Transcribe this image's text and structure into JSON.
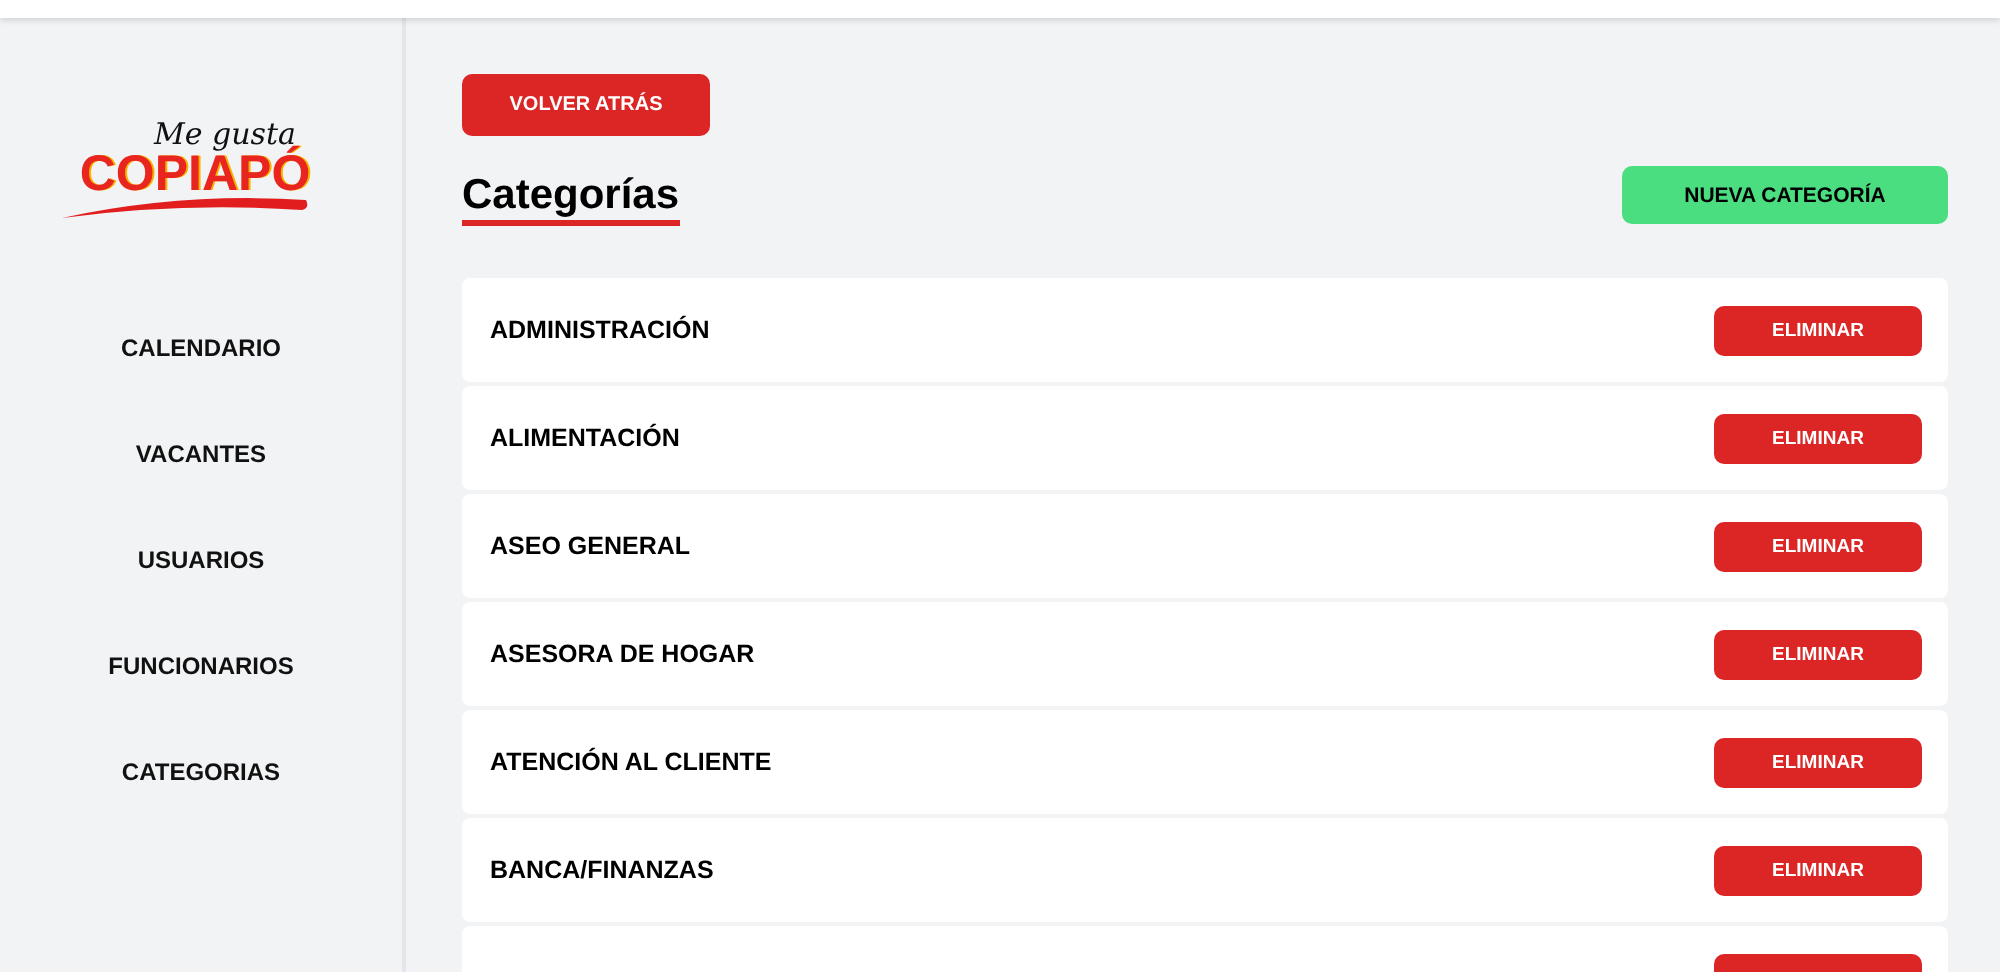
{
  "sidebar": {
    "logo": {
      "tagline": "Me gusta",
      "name": "COPIAPÓ"
    },
    "items": [
      {
        "label": "CALENDARIO"
      },
      {
        "label": "VACANTES"
      },
      {
        "label": "USUARIOS"
      },
      {
        "label": "FUNCIONARIOS"
      },
      {
        "label": "CATEGORIAS"
      }
    ]
  },
  "back_button": "VOLVER ATRÁS",
  "title": "Categorías",
  "new_button": "NUEVA CATEGORÍA",
  "categories": [
    {
      "name": "ADMINISTRACIÓN",
      "action": "ELIMINAR"
    },
    {
      "name": "ALIMENTACIÓN",
      "action": "ELIMINAR"
    },
    {
      "name": "ASEO GENERAL",
      "action": "ELIMINAR"
    },
    {
      "name": "ASESORA DE HOGAR",
      "action": "ELIMINAR"
    },
    {
      "name": "ATENCIÓN AL CLIENTE",
      "action": "ELIMINAR"
    },
    {
      "name": "BANCA/FINANZAS",
      "action": "ELIMINAR"
    }
  ]
}
